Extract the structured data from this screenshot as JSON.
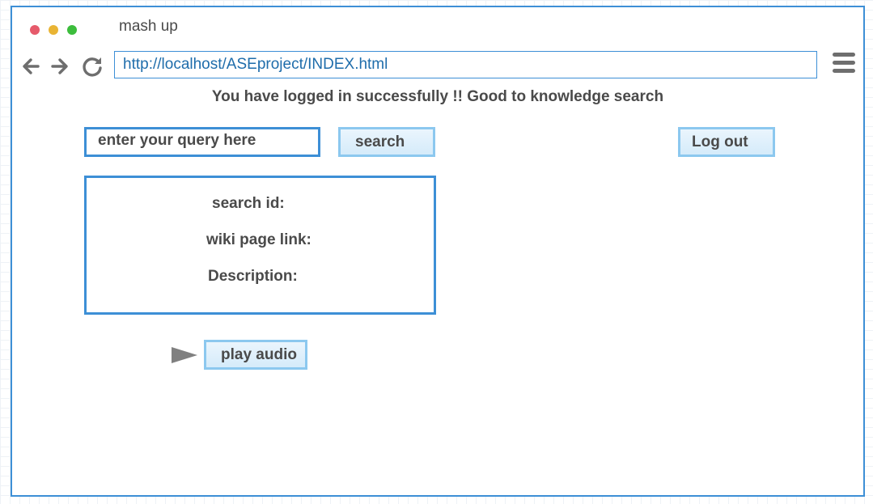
{
  "window": {
    "title": "mash up",
    "traffic_lights": {
      "close_color": "#e65a6b",
      "minimize_color": "#e9b434",
      "maximize_color": "#3cbd3c"
    }
  },
  "toolbar": {
    "back_icon": "arrow-left-icon",
    "forward_icon": "arrow-right-icon",
    "reload_icon": "reload-icon",
    "url": "http://localhost/ASEproject/INDEX.html",
    "menu_icon": "hamburger-menu-icon"
  },
  "main": {
    "status_message": "You have logged in successfully !! Good to knowledge search",
    "query_placeholder": "enter your query here",
    "search_label": "search",
    "logout_label": "Log out",
    "result": {
      "search_id_label": "search id:",
      "wiki_link_label": "wiki page link:",
      "description_label": "Description:"
    },
    "play_icon": "play-icon",
    "play_audio_label": "play audio"
  },
  "colors": {
    "accent": "#3d8fd6",
    "button_border": "#8cc8ef",
    "button_fill": "#d5ebfa",
    "text": "#4a4a4a",
    "url_text": "#1f6dab"
  }
}
